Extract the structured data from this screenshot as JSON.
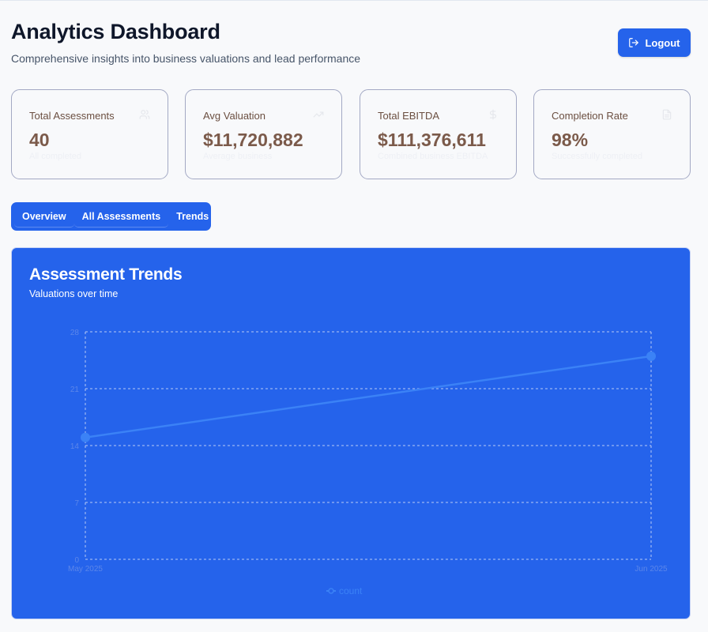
{
  "header": {
    "title": "Analytics Dashboard",
    "subtitle": "Comprehensive insights into business valuations and lead performance",
    "logout_label": "Logout"
  },
  "stats": [
    {
      "label": "Total Assessments",
      "value": "40",
      "sub": "All completed",
      "icon": "users-icon"
    },
    {
      "label": "Avg Valuation",
      "value": "$11,720,882",
      "sub": "Average business",
      "icon": "trending-up-icon"
    },
    {
      "label": "Total EBITDA",
      "value": "$111,376,611",
      "sub": "Combined business EBITDA",
      "icon": "dollar-icon"
    },
    {
      "label": "Completion Rate",
      "value": "98%",
      "sub": "Successfully completed",
      "icon": "file-icon"
    }
  ],
  "tabs": [
    {
      "label": "Overview"
    },
    {
      "label": "All Assessments"
    },
    {
      "label": "Trends"
    }
  ],
  "chart_card": {
    "title": "Assessment Trends",
    "subtitle": "Valuations over time"
  },
  "colors": {
    "brand": "#2563eb",
    "line": "#3b82f6",
    "axis_text": "#5b86ea",
    "grid": "#b8c8f5"
  },
  "chart_data": {
    "type": "line",
    "x": [
      "May 2025",
      "Jun 2025"
    ],
    "series": [
      {
        "name": "count",
        "values": [
          15,
          25
        ]
      }
    ],
    "ylim": [
      0,
      28
    ],
    "yticks": [
      0,
      7,
      14,
      21,
      28
    ],
    "grid": true,
    "legend": "bottom"
  }
}
